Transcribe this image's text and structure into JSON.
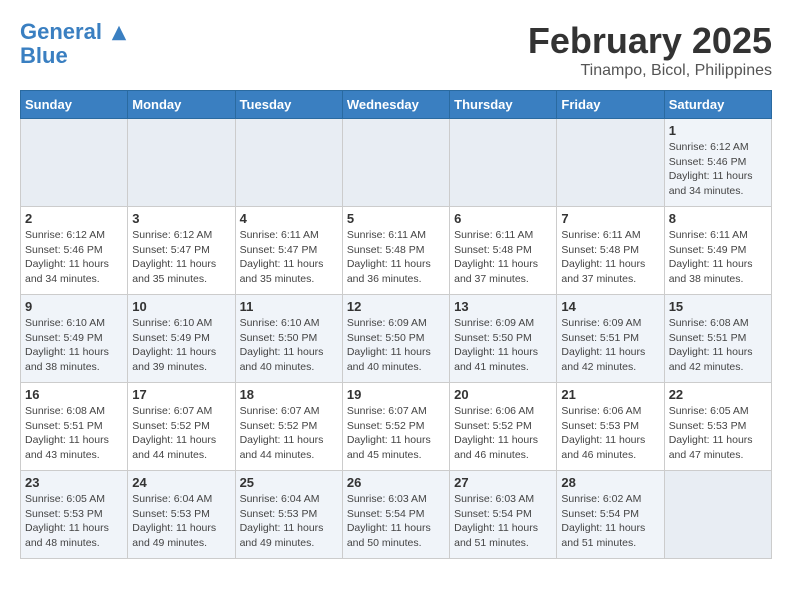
{
  "header": {
    "logo_line1": "General",
    "logo_line2": "Blue",
    "month_title": "February 2025",
    "location": "Tinampo, Bicol, Philippines"
  },
  "days_of_week": [
    "Sunday",
    "Monday",
    "Tuesday",
    "Wednesday",
    "Thursday",
    "Friday",
    "Saturday"
  ],
  "weeks": [
    [
      {
        "day": "",
        "info": ""
      },
      {
        "day": "",
        "info": ""
      },
      {
        "day": "",
        "info": ""
      },
      {
        "day": "",
        "info": ""
      },
      {
        "day": "",
        "info": ""
      },
      {
        "day": "",
        "info": ""
      },
      {
        "day": "1",
        "info": "Sunrise: 6:12 AM\nSunset: 5:46 PM\nDaylight: 11 hours\nand 34 minutes."
      }
    ],
    [
      {
        "day": "2",
        "info": "Sunrise: 6:12 AM\nSunset: 5:46 PM\nDaylight: 11 hours\nand 34 minutes."
      },
      {
        "day": "3",
        "info": "Sunrise: 6:12 AM\nSunset: 5:47 PM\nDaylight: 11 hours\nand 35 minutes."
      },
      {
        "day": "4",
        "info": "Sunrise: 6:11 AM\nSunset: 5:47 PM\nDaylight: 11 hours\nand 35 minutes."
      },
      {
        "day": "5",
        "info": "Sunrise: 6:11 AM\nSunset: 5:48 PM\nDaylight: 11 hours\nand 36 minutes."
      },
      {
        "day": "6",
        "info": "Sunrise: 6:11 AM\nSunset: 5:48 PM\nDaylight: 11 hours\nand 37 minutes."
      },
      {
        "day": "7",
        "info": "Sunrise: 6:11 AM\nSunset: 5:48 PM\nDaylight: 11 hours\nand 37 minutes."
      },
      {
        "day": "8",
        "info": "Sunrise: 6:11 AM\nSunset: 5:49 PM\nDaylight: 11 hours\nand 38 minutes."
      }
    ],
    [
      {
        "day": "9",
        "info": "Sunrise: 6:10 AM\nSunset: 5:49 PM\nDaylight: 11 hours\nand 38 minutes."
      },
      {
        "day": "10",
        "info": "Sunrise: 6:10 AM\nSunset: 5:49 PM\nDaylight: 11 hours\nand 39 minutes."
      },
      {
        "day": "11",
        "info": "Sunrise: 6:10 AM\nSunset: 5:50 PM\nDaylight: 11 hours\nand 40 minutes."
      },
      {
        "day": "12",
        "info": "Sunrise: 6:09 AM\nSunset: 5:50 PM\nDaylight: 11 hours\nand 40 minutes."
      },
      {
        "day": "13",
        "info": "Sunrise: 6:09 AM\nSunset: 5:50 PM\nDaylight: 11 hours\nand 41 minutes."
      },
      {
        "day": "14",
        "info": "Sunrise: 6:09 AM\nSunset: 5:51 PM\nDaylight: 11 hours\nand 42 minutes."
      },
      {
        "day": "15",
        "info": "Sunrise: 6:08 AM\nSunset: 5:51 PM\nDaylight: 11 hours\nand 42 minutes."
      }
    ],
    [
      {
        "day": "16",
        "info": "Sunrise: 6:08 AM\nSunset: 5:51 PM\nDaylight: 11 hours\nand 43 minutes."
      },
      {
        "day": "17",
        "info": "Sunrise: 6:07 AM\nSunset: 5:52 PM\nDaylight: 11 hours\nand 44 minutes."
      },
      {
        "day": "18",
        "info": "Sunrise: 6:07 AM\nSunset: 5:52 PM\nDaylight: 11 hours\nand 44 minutes."
      },
      {
        "day": "19",
        "info": "Sunrise: 6:07 AM\nSunset: 5:52 PM\nDaylight: 11 hours\nand 45 minutes."
      },
      {
        "day": "20",
        "info": "Sunrise: 6:06 AM\nSunset: 5:52 PM\nDaylight: 11 hours\nand 46 minutes."
      },
      {
        "day": "21",
        "info": "Sunrise: 6:06 AM\nSunset: 5:53 PM\nDaylight: 11 hours\nand 46 minutes."
      },
      {
        "day": "22",
        "info": "Sunrise: 6:05 AM\nSunset: 5:53 PM\nDaylight: 11 hours\nand 47 minutes."
      }
    ],
    [
      {
        "day": "23",
        "info": "Sunrise: 6:05 AM\nSunset: 5:53 PM\nDaylight: 11 hours\nand 48 minutes."
      },
      {
        "day": "24",
        "info": "Sunrise: 6:04 AM\nSunset: 5:53 PM\nDaylight: 11 hours\nand 49 minutes."
      },
      {
        "day": "25",
        "info": "Sunrise: 6:04 AM\nSunset: 5:53 PM\nDaylight: 11 hours\nand 49 minutes."
      },
      {
        "day": "26",
        "info": "Sunrise: 6:03 AM\nSunset: 5:54 PM\nDaylight: 11 hours\nand 50 minutes."
      },
      {
        "day": "27",
        "info": "Sunrise: 6:03 AM\nSunset: 5:54 PM\nDaylight: 11 hours\nand 51 minutes."
      },
      {
        "day": "28",
        "info": "Sunrise: 6:02 AM\nSunset: 5:54 PM\nDaylight: 11 hours\nand 51 minutes."
      },
      {
        "day": "",
        "info": ""
      }
    ]
  ]
}
